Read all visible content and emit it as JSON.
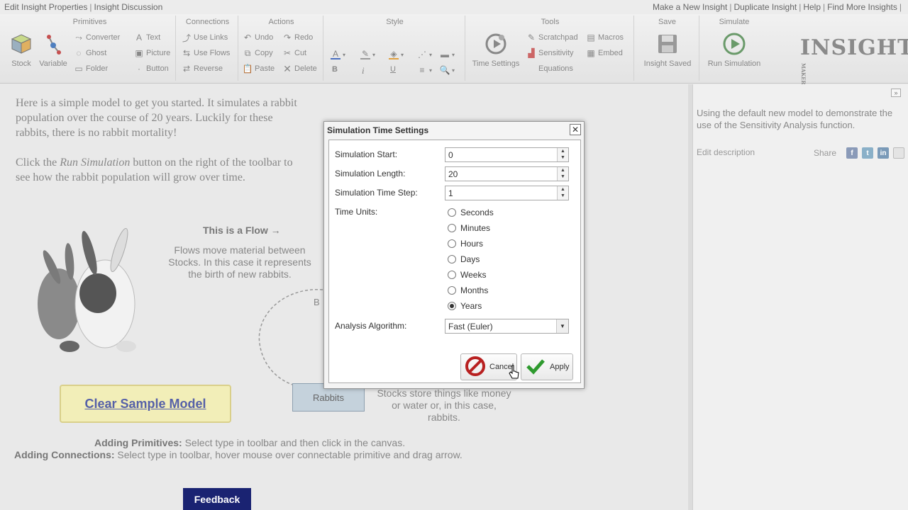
{
  "top_links": {
    "left": [
      "Edit Insight Properties",
      "Insight Discussion"
    ],
    "right": [
      "Make a New Insight",
      "Duplicate Insight",
      "Help",
      "Find More Insights"
    ]
  },
  "toolbar": {
    "primitives": {
      "title": "Primitives",
      "stock": "Stock",
      "variable": "Variable",
      "converter": "Converter",
      "ghost": "Ghost",
      "folder": "Folder",
      "text": "Text",
      "picture": "Picture",
      "button": "Button"
    },
    "connections": {
      "title": "Connections",
      "use_links": "Use Links",
      "use_flows": "Use Flows",
      "reverse": "Reverse"
    },
    "actions": {
      "title": "Actions",
      "undo": "Undo",
      "redo": "Redo",
      "copy": "Copy",
      "cut": "Cut",
      "paste": "Paste",
      "delete": "Delete"
    },
    "style": {
      "title": "Style",
      "bold": "B",
      "italic": "i",
      "underline": "U"
    },
    "tools": {
      "title": "Tools",
      "time_settings": "Time Settings",
      "scratchpad": "Scratchpad",
      "sensitivity": "Sensitivity",
      "equations": "Equations",
      "macros": "Macros",
      "embed": "Embed"
    },
    "save": {
      "title": "Save",
      "label": "Insight Saved"
    },
    "simulate": {
      "title": "Simulate",
      "label": "Run Simulation"
    },
    "logo": "INSIGHT",
    "logo_small": "MAKER"
  },
  "canvas": {
    "intro_p1": "Here is a simple model to get you started. It simulates a rabbit population over the course of 20 years. Luckily for these rabbits, there is no rabbit mortality!",
    "intro_p2_a": "Click the ",
    "intro_p2_em": "Run Simulation",
    "intro_p2_b": " button on the right of the toolbar to see how the rabbit population will grow over time.",
    "flow_title": "This is a Flow →",
    "flow_desc": "Flows move material between Stocks. In this case it represents the birth of new rabbits.",
    "stock_label": "Rabbits",
    "stock_desc": "Stocks store things like money or water or, in this case, rabbits.",
    "hidden_label_fragment": "B",
    "clear_button": "Clear Sample Model",
    "help1_bold": "Adding Primitives:",
    "help1_text": " Select type in toolbar and then click in the canvas.",
    "help2_bold": "Adding Connections:",
    "help2_text": " Select type in toolbar, hover mouse over connectable primitive and drag arrow.",
    "feedback": "Feedback"
  },
  "panel": {
    "description": "Using the default new model to demonstrate the use of the Sensitivity Analysis function.",
    "edit_description": "Edit description",
    "share": "Share"
  },
  "dialog": {
    "title": "Simulation Time Settings",
    "start_label": "Simulation Start:",
    "start_value": "0",
    "length_label": "Simulation Length:",
    "length_value": "20",
    "step_label": "Simulation Time Step:",
    "step_value": "1",
    "units_label": "Time Units:",
    "units": [
      "Seconds",
      "Minutes",
      "Hours",
      "Days",
      "Weeks",
      "Months",
      "Years"
    ],
    "selected_unit": "Years",
    "algorithm_label": "Analysis Algorithm:",
    "algorithm_value": "Fast (Euler)",
    "cancel": "Cancel",
    "apply": "Apply"
  },
  "colors": {
    "feedback_bg": "#1a2372",
    "clear_button_bg": "#f2eeb8",
    "stock_fill": "#c5d2dc",
    "apply_check": "#2e9a2e",
    "cancel_icon": "#b82020"
  }
}
